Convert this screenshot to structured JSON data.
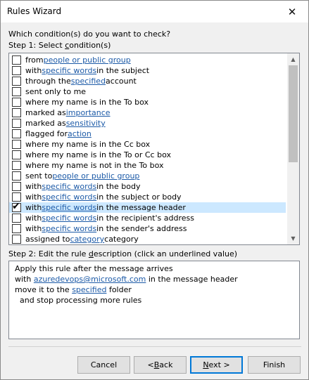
{
  "window": {
    "title": "Rules Wizard",
    "close_glyph": "✕"
  },
  "question": "Which condition(s) do you want to check?",
  "step1": {
    "prefix": "Step 1: Select ",
    "underlined": "c",
    "suffix": "ondition(s)"
  },
  "conditions": [
    {
      "checked": false,
      "pre": "from ",
      "link": "people or public group",
      "post": ""
    },
    {
      "checked": false,
      "pre": "with ",
      "link": "specific words",
      "post": " in the subject"
    },
    {
      "checked": false,
      "pre": "through the ",
      "link": "specified",
      "post": " account"
    },
    {
      "checked": false,
      "pre": "sent only to me",
      "link": "",
      "post": ""
    },
    {
      "checked": false,
      "pre": "where my name is in the To box",
      "link": "",
      "post": ""
    },
    {
      "checked": false,
      "pre": "marked as ",
      "link": "importance",
      "post": ""
    },
    {
      "checked": false,
      "pre": "marked as ",
      "link": "sensitivity",
      "post": ""
    },
    {
      "checked": false,
      "pre": "flagged for ",
      "link": "action",
      "post": ""
    },
    {
      "checked": false,
      "pre": "where my name is in the Cc box",
      "link": "",
      "post": ""
    },
    {
      "checked": false,
      "pre": "where my name is in the To or Cc box",
      "link": "",
      "post": ""
    },
    {
      "checked": false,
      "pre": "where my name is not in the To box",
      "link": "",
      "post": ""
    },
    {
      "checked": false,
      "pre": "sent to ",
      "link": "people or public group",
      "post": ""
    },
    {
      "checked": false,
      "pre": "with ",
      "link": "specific words",
      "post": " in the body"
    },
    {
      "checked": false,
      "pre": "with ",
      "link": "specific words",
      "post": " in the subject or body"
    },
    {
      "checked": true,
      "selected": true,
      "pre": "with ",
      "link": "specific words",
      "post": " in the message header"
    },
    {
      "checked": false,
      "pre": "with ",
      "link": "specific words",
      "post": " in the recipient's address"
    },
    {
      "checked": false,
      "pre": "with ",
      "link": "specific words",
      "post": " in the sender's address"
    },
    {
      "checked": false,
      "pre": "assigned to ",
      "link": "category",
      "post": " category"
    }
  ],
  "step2": {
    "prefix": "Step 2: Edit the rule ",
    "underlined": "d",
    "suffix": "escription (click an underlined value)"
  },
  "description": [
    {
      "pre": "Apply this rule after the message arrives",
      "link": "",
      "post": ""
    },
    {
      "pre": "with ",
      "link": "azuredevops@microsoft.com",
      "post": " in the message header"
    },
    {
      "pre": "move it to the ",
      "link": "specified",
      "post": " folder"
    },
    {
      "pre": "  and stop processing more rules",
      "link": "",
      "post": ""
    }
  ],
  "buttons": {
    "cancel": "Cancel",
    "back": {
      "prefix": "< ",
      "underlined": "B",
      "suffix": "ack"
    },
    "next": {
      "underlined": "N",
      "suffix": "ext >"
    },
    "finish": "Finish"
  },
  "colors": {
    "link": "#1c5aa7",
    "selection": "#cce8ff",
    "default_button_border": "#0078d7"
  }
}
